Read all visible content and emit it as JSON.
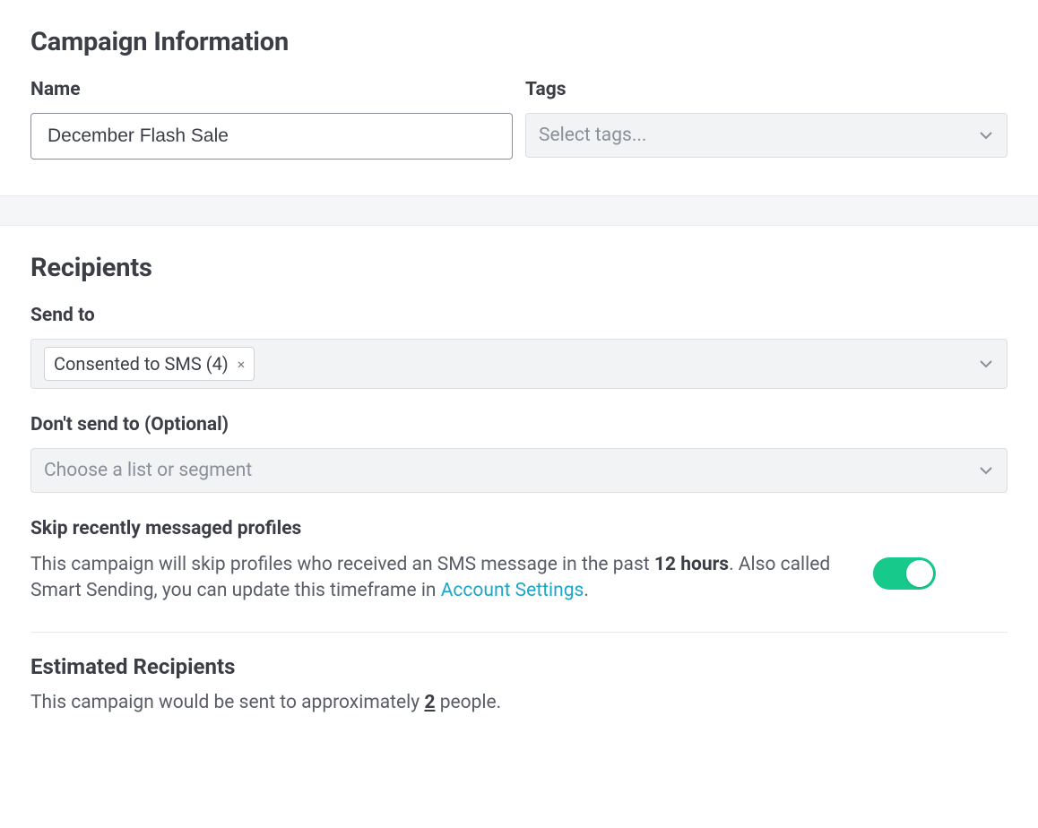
{
  "campaign_info": {
    "heading": "Campaign Information",
    "name_label": "Name",
    "name_value": "December Flash Sale",
    "tags_label": "Tags",
    "tags_placeholder": "Select tags..."
  },
  "recipients": {
    "heading": "Recipients",
    "send_to_label": "Send to",
    "send_to_chip": "Consented to SMS (4)",
    "dont_send_label": "Don't send to",
    "dont_send_optional": "(Optional)",
    "dont_send_placeholder": "Choose a list or segment",
    "skip_heading": "Skip recently messaged profiles",
    "skip_text_pre": "This campaign will skip profiles who received an SMS message in the past ",
    "skip_hours": "12 hours",
    "skip_text_mid": ". Also called Smart Sending, you can update this timeframe in ",
    "skip_link": "Account Settings",
    "skip_text_post": ".",
    "estimated_heading": "Estimated Recipients",
    "estimated_pre": "This campaign would be sent to approximately ",
    "estimated_count": "2",
    "estimated_post": " people."
  }
}
